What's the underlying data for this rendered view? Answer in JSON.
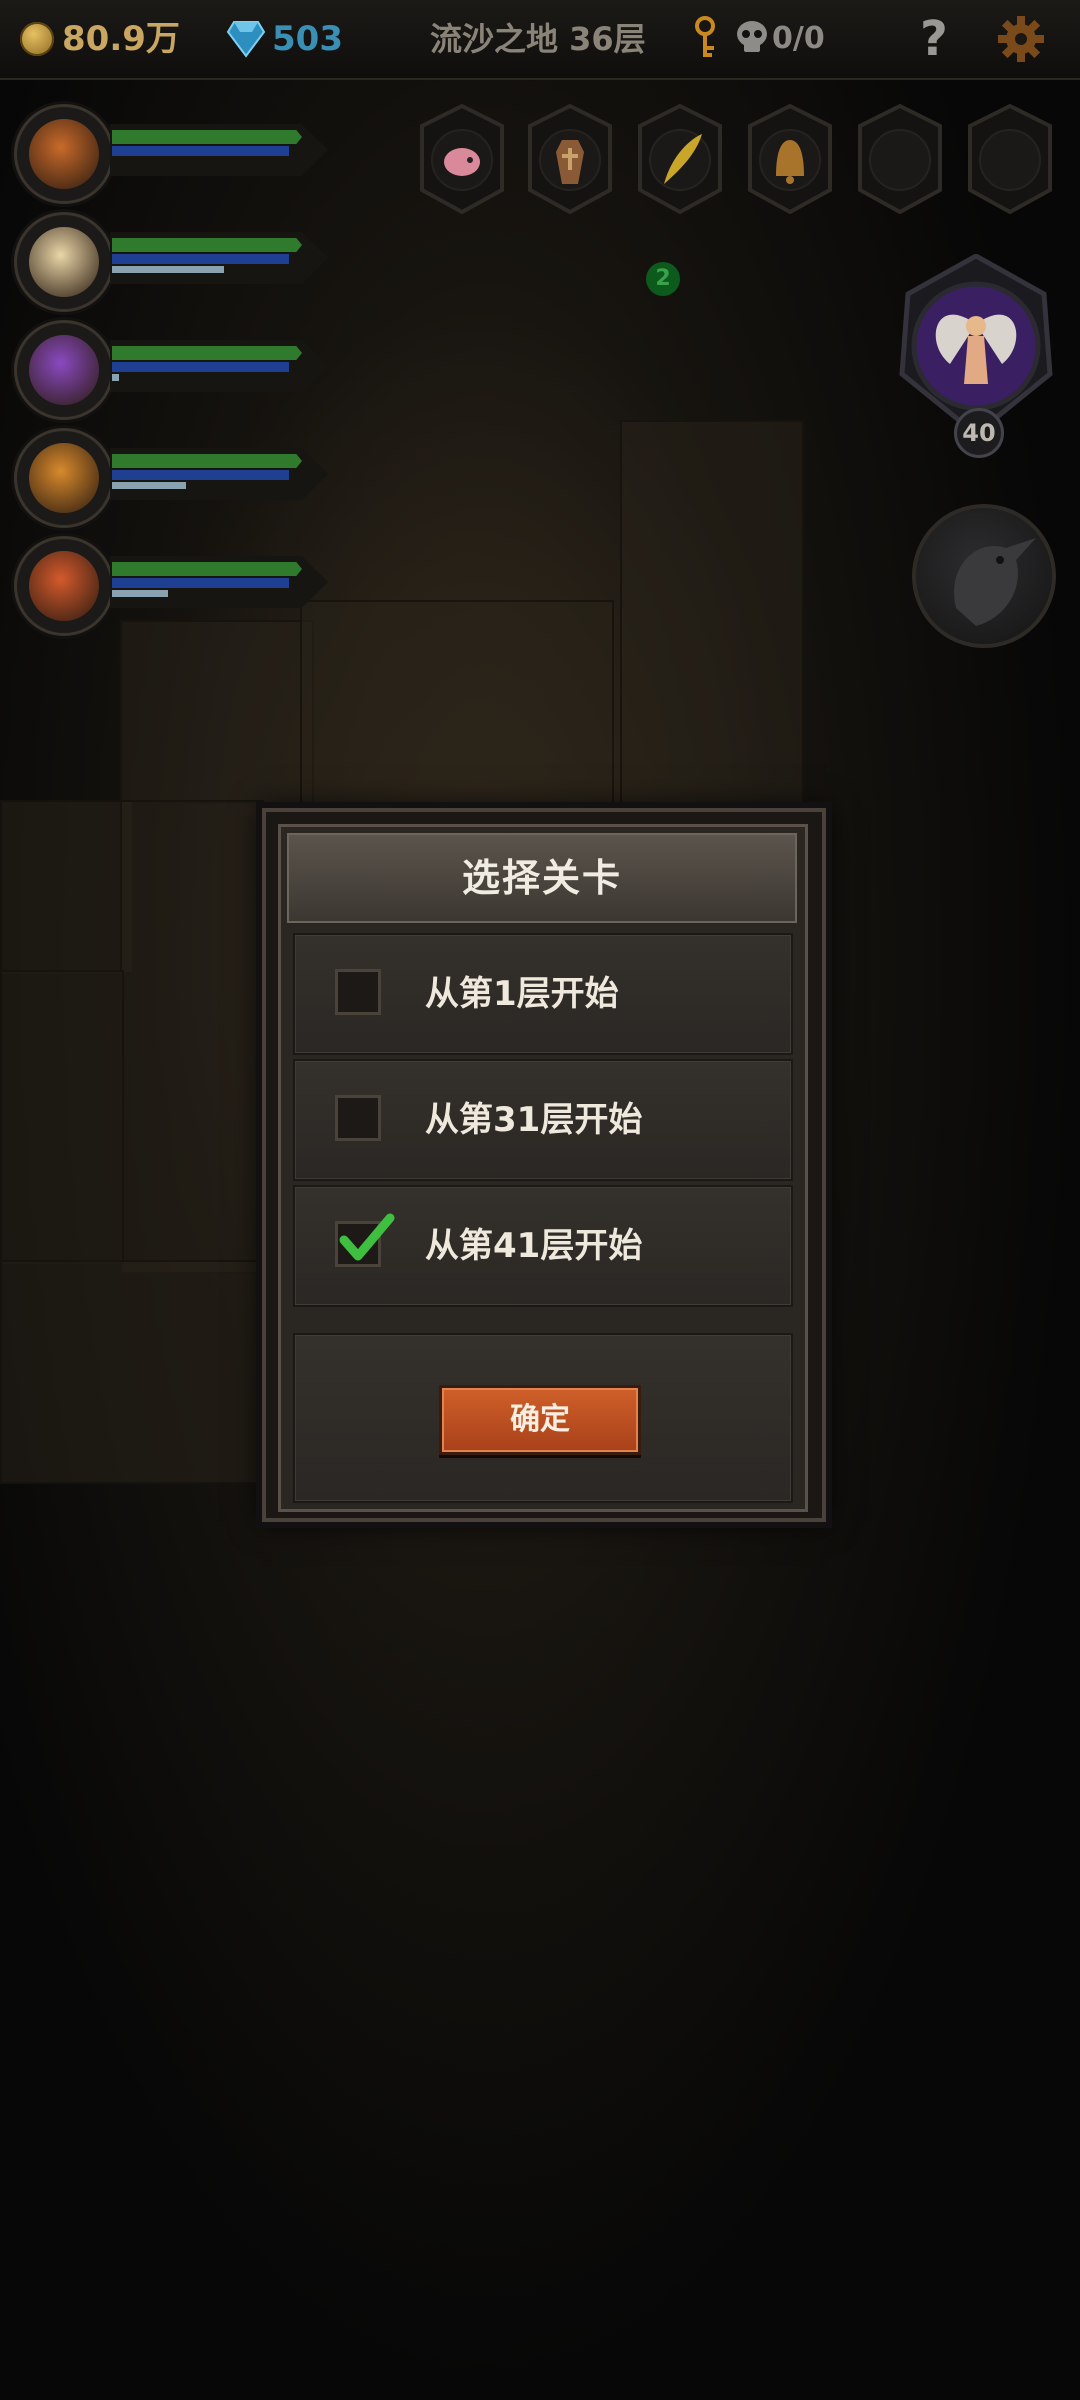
{
  "topbar": {
    "gold": "80.9万",
    "gems": "503",
    "level_name": "流沙之地 36层",
    "kills": "0/0",
    "help": "?"
  },
  "heroes": [
    {
      "name": "hero-1",
      "hp": 0.95,
      "mp": 0.95,
      "xp": 0.0,
      "color": "#c96a2a"
    },
    {
      "name": "hero-2",
      "hp": 0.95,
      "mp": 0.95,
      "xp": 0.6,
      "color": "#e9d6a8"
    },
    {
      "name": "hero-3",
      "hp": 0.95,
      "mp": 0.95,
      "xp": 0.04,
      "color": "#8a4ac0"
    },
    {
      "name": "hero-4",
      "hp": 0.95,
      "mp": 0.95,
      "xp": 0.4,
      "color": "#d88a2c"
    },
    {
      "name": "hero-5",
      "hp": 0.95,
      "mp": 0.95,
      "xp": 0.3,
      "color": "#d45a2c"
    }
  ],
  "item_slots": [
    "pig-icon",
    "coffin-icon",
    "feather-icon",
    "bell-icon",
    "empty-slot",
    "empty-slot"
  ],
  "badge_count": "2",
  "boss": {
    "level": "40"
  },
  "dialog": {
    "title": "选择关卡",
    "options": [
      {
        "label": "从第1层开始",
        "checked": false
      },
      {
        "label": "从第31层开始",
        "checked": false
      },
      {
        "label": "从第41层开始",
        "checked": true
      }
    ],
    "confirm_label": "确定"
  },
  "colors": {
    "gold": "#c9a662",
    "gem": "#3a8fb5",
    "confirm": "#c0531f",
    "check": "#3fbf3f"
  }
}
